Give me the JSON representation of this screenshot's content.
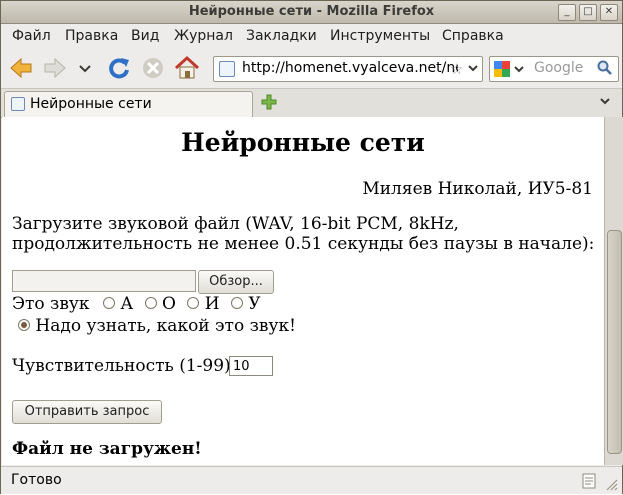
{
  "window": {
    "title": "Нейронные сети - Mozilla Firefox"
  },
  "menu": [
    "Файл",
    "Правка",
    "Вид",
    "Журнал",
    "Закладки",
    "Инструменты",
    "Справка"
  ],
  "nav": {
    "url": "http://homenet.vyalceva.net/ne",
    "search_placeholder": "Google"
  },
  "tab": {
    "label": "Нейронные сети"
  },
  "page": {
    "heading": "Нейронные сети",
    "author": "Миляев Николай, ИУ5-81",
    "instruction_line1": "Загрузите звуковой файл (WAV, 16-bit PCM, 8kHz,",
    "instruction_line2": "продолжительность не менее 0.51 секунды без паузы в начале):",
    "browse_label": "Обзор...",
    "sound_prefix": "Это звук",
    "radio_options": [
      "А",
      "О",
      "И",
      "У"
    ],
    "unknown_label": "Надо узнать, какой это звук!",
    "sensitivity_label": "Чувствительность (1-99):",
    "sensitivity_value": "10",
    "submit_label": "Отправить запрос",
    "result": "Файл не загружен!"
  },
  "status": {
    "text": "Готово"
  },
  "icons": {
    "back": "back-arrow-icon",
    "forward": "forward-arrow-icon",
    "reload": "reload-icon",
    "stop": "stop-icon",
    "home": "home-icon",
    "star": "bookmark-star-icon",
    "search": "magnifier-icon"
  }
}
